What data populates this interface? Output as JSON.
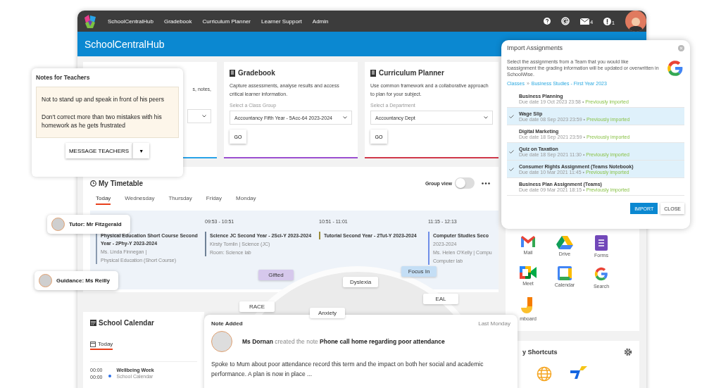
{
  "nav": {
    "items": [
      {
        "label": "SchoolCentralHub"
      },
      {
        "label": "Gradebook"
      },
      {
        "label": "Curriculum Planner"
      },
      {
        "label": "Learner Support"
      },
      {
        "label": "Admin"
      }
    ],
    "mail_count": "4",
    "alert_count": "1"
  },
  "header": {
    "title": "SchoolCentralHub"
  },
  "cards": [
    {
      "kind": "partial",
      "description": "s, notes,",
      "color": "#29a3e8"
    },
    {
      "kind": "full",
      "title": "Gradebook",
      "description": "Capture assessments, analyse results and access critical learner information.",
      "select_label": "Select a Class Group",
      "select_value": "Accountancy Fifth Year - 5Acc-64 2023-2024",
      "button": "GO",
      "color": "#9b4fd0"
    },
    {
      "kind": "full",
      "title": "Curriculum Planner",
      "description": "Use common framework and a collaborative approach to plan for your subject.",
      "select_label": "Select a Department",
      "select_value": "Accountancy Dept",
      "button": "GO",
      "color": "#d0384a"
    }
  ],
  "timetable": {
    "title": "My Timetable",
    "group_view_label": "Group view",
    "group_view_on": false,
    "tabs": [
      {
        "label": "Today",
        "selected": true
      },
      {
        "label": "Wednesday",
        "selected": false
      },
      {
        "label": "Thursday",
        "selected": false
      },
      {
        "label": "Friday",
        "selected": false
      },
      {
        "label": "Monday",
        "selected": false
      }
    ],
    "entries": [
      {
        "title": "Physical Education Short Course Second Year - 2Phy-Y 2023-2024",
        "lines": [
          "Ms. Linda Finnegan |",
          "Physical Education (Short Course)"
        ],
        "color": "#8a9bb0"
      },
      {
        "time": "09:53 - 10:51",
        "title": "Science JC Second Year - 2Sci-Y 2023-2024",
        "lines": [
          "Kirsty Tomlin | Science (JC)",
          "Room: Science lab"
        ],
        "color": "#6f8196"
      },
      {
        "time": "10:51 - 11:01",
        "title": "Tutorial Second Year - 2Tut-Y 2023-2024",
        "color": "#9a8a3a"
      },
      {
        "time": "11:15 - 12:13",
        "title": "Computer Studies Seco",
        "lines": [
          "2023-2024",
          "Ms. Helen O'Kelly | Compu",
          "Computer lab"
        ],
        "color": "#6f8ee8"
      }
    ]
  },
  "calendar": {
    "title": "School Calendar",
    "tab": "Today",
    "events": [
      {
        "start": "00:00",
        "end": "00:00",
        "title": "Wellbeing Week",
        "subtitle": "School Calendar"
      }
    ]
  },
  "apps": [
    {
      "kind": "mail",
      "label": "Mail"
    },
    {
      "kind": "drive",
      "label": "Drive"
    },
    {
      "kind": "forms",
      "label": "Forms"
    },
    {
      "kind": "meet",
      "label": "Meet"
    },
    {
      "kind": "calendar",
      "label": "Calendar"
    },
    {
      "kind": "search",
      "label": "Search"
    },
    {
      "kind": "jamboard",
      "label": "mboard"
    }
  ],
  "shortcuts": {
    "title": "y Shortcuts",
    "items": [
      {
        "kind": "globe"
      },
      {
        "kind": "arrow"
      }
    ]
  },
  "notes_panel": {
    "title": "Notes for Teachers",
    "notes": [
      "Not to stand up and speak in front of his peers",
      "Don't correct more than two mistakes with his homework as he gets frustrated"
    ],
    "button": "MESSAGE TEACHERS",
    "caret": "▼"
  },
  "contacts": [
    {
      "label": "Tutor: Mr Fitzgerald"
    },
    {
      "label": "Guidance: Ms Reilly"
    }
  ],
  "tags": [
    {
      "label": "Gifted",
      "color": "#d6c8ec"
    },
    {
      "label": "Focus In",
      "color": "#c4def5"
    },
    {
      "label": "Dyslexia",
      "color": "#ffffff"
    },
    {
      "label": "EAL",
      "color": "#ffffff"
    },
    {
      "label": "RACE",
      "color": "#ffffff"
    },
    {
      "label": "Anxiety",
      "color": "#ffffff"
    }
  ],
  "note_added": {
    "title": "Note Added",
    "time": "Last Monday",
    "summary": "**Ms Dornan** created the note **Phone call home regarding poor attendance**",
    "body": "Spoke to Mum about poor attendance record this term and the impact on both her social and academic performance. A plan is now in place ..."
  },
  "import_dialog": {
    "title": "Import Assignments",
    "description": "Select the assignments from a Team that you would like toassignment the grading information will be updated or overwritten in SchoolWise.",
    "breadcrumb": [
      "Classes",
      "Business Studies - First Year 2023"
    ],
    "separator": "»",
    "assignments": [
      {
        "name": "Business Planning",
        "due": "Due date 19 Oct 2023 23:58 •",
        "status": "Previously imported",
        "selected": false
      },
      {
        "name": "Wage Slip",
        "due": "Due date 08 Sep 2023 23:59 •",
        "status": "Previously imported",
        "selected": true
      },
      {
        "name": "Digital Marketing",
        "due": "Due date 18 Sep 2021 23:59 •",
        "status": "Previously imported",
        "selected": false
      },
      {
        "name": "Quiz on Taxation",
        "due": "Due date 18 Sep 2021 11:30 •",
        "status": "Previously imported",
        "selected": true
      },
      {
        "name": "Consumer Rights Assignment (Teams Notebook)",
        "due": "Due date 10 Mar 2021 11:45 •",
        "status": "Previously imported",
        "selected": true
      },
      {
        "name": "Business Plan Assignment (Teams)",
        "due": "Due date 09 Mar 2021 18:15 •",
        "status": "Previously imported",
        "selected": false
      }
    ],
    "buttons": [
      "IMPORT",
      "CLOSE"
    ]
  }
}
